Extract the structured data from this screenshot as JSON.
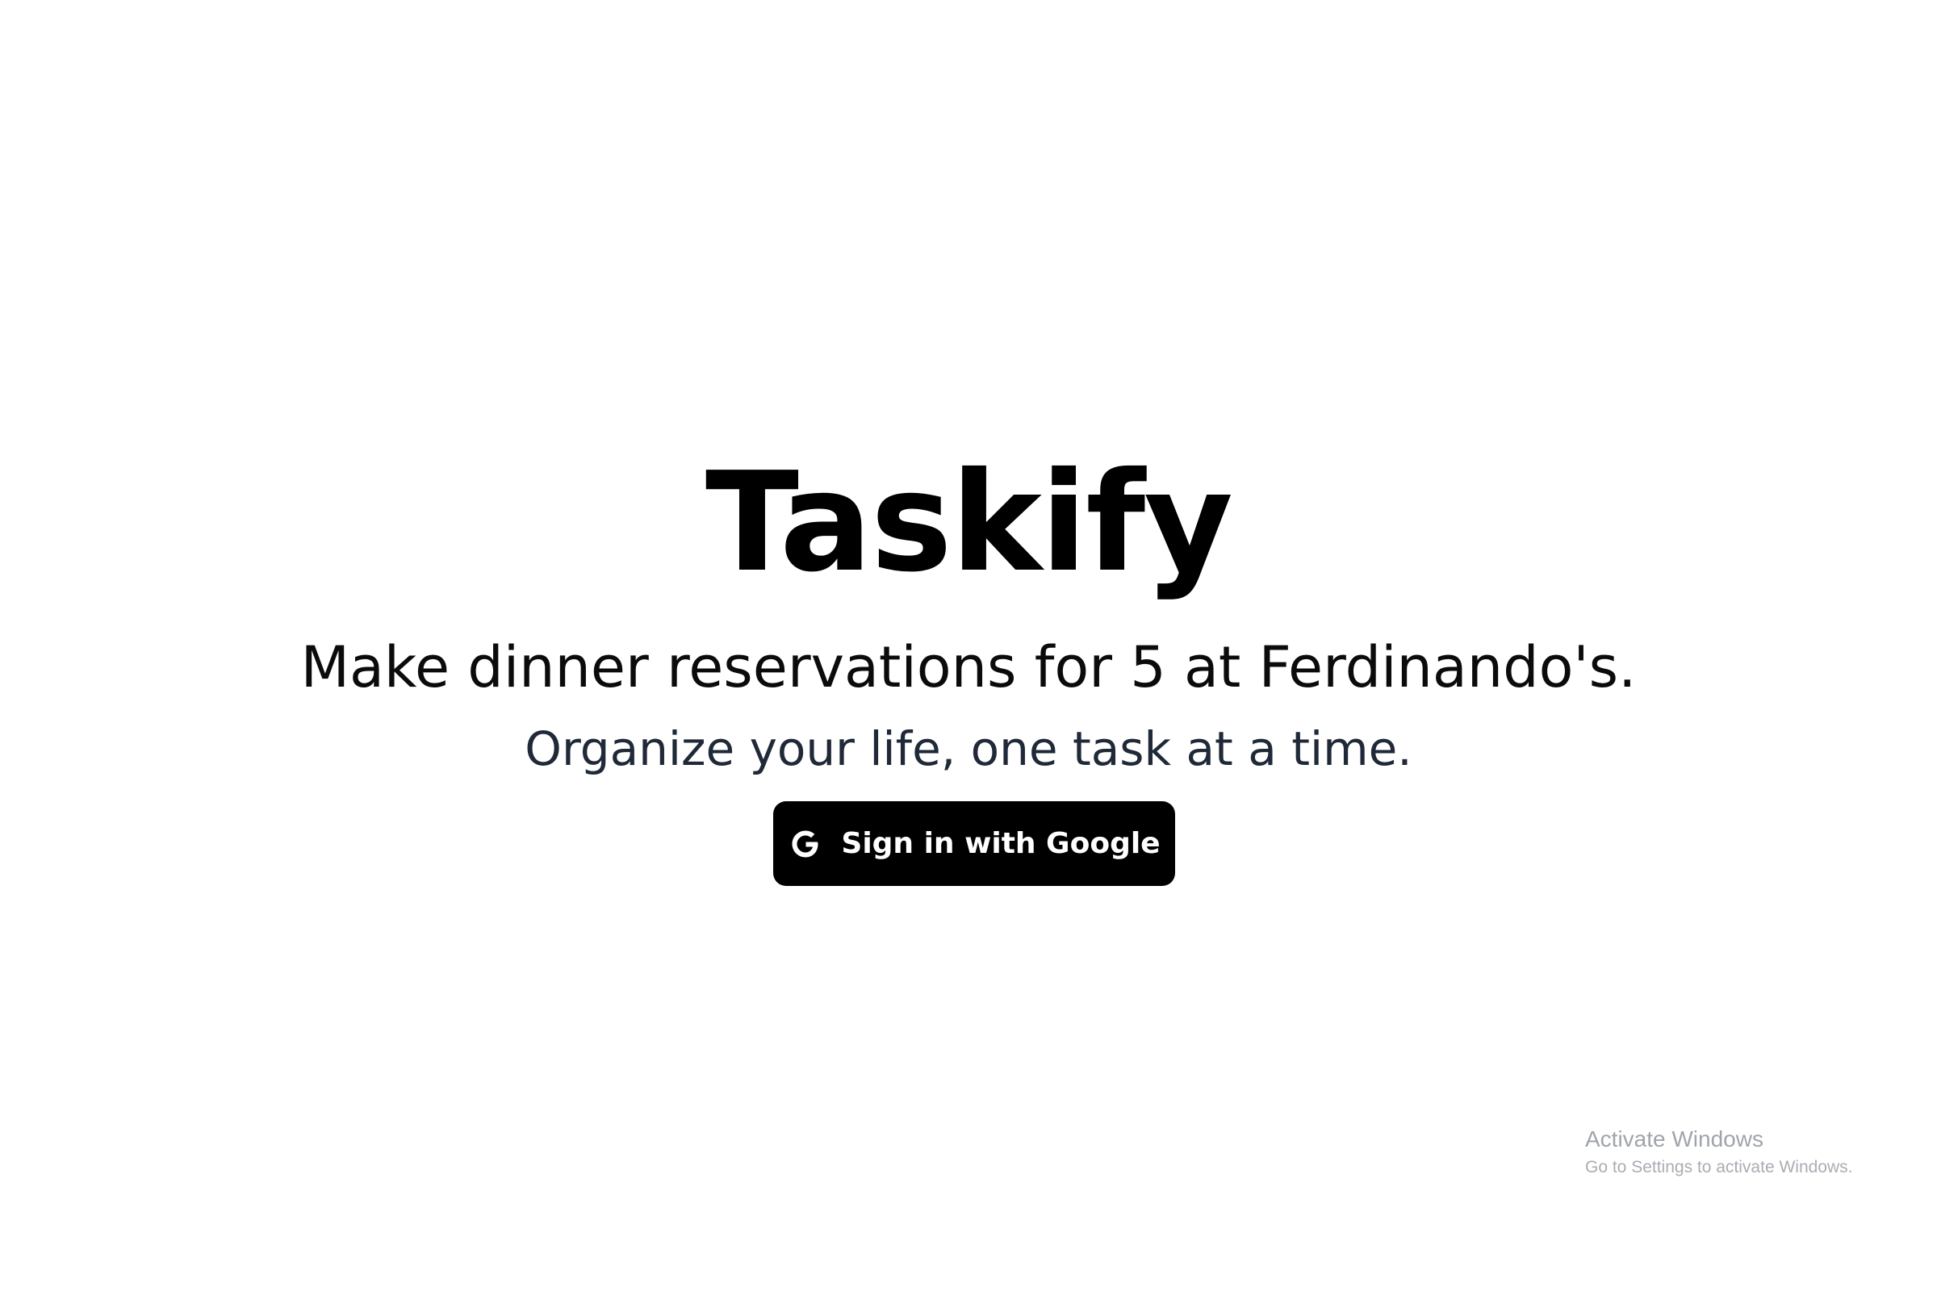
{
  "app": {
    "title": "Taskify",
    "task_text": "Make dinner reservations for 5 at Ferdinando's.",
    "tagline": "Organize your life, one task at a time."
  },
  "signin": {
    "label": "Sign in with Google",
    "icon": "google-g-icon"
  },
  "watermark": {
    "line1": "Activate Windows",
    "line2": "Go to Settings to activate Windows."
  },
  "colors": {
    "background": "#ffffff",
    "button_bg": "#000000",
    "button_text": "#ffffff",
    "tagline": "#1f2937"
  }
}
